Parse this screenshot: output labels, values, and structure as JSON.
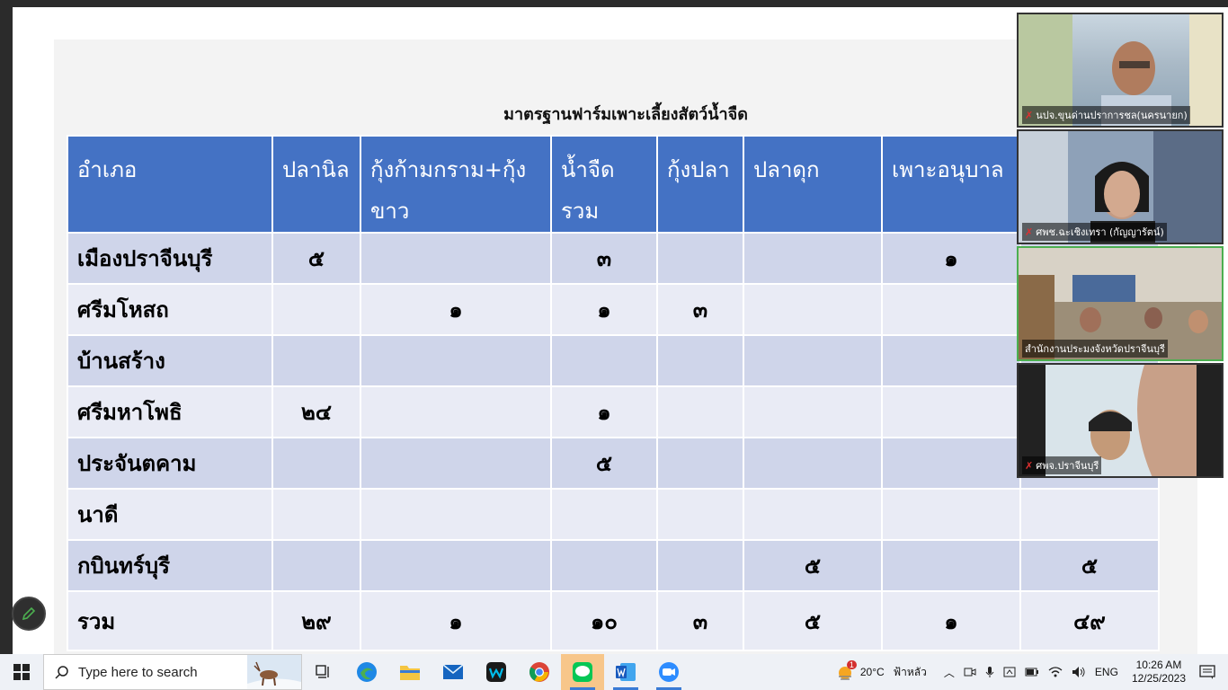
{
  "slide": {
    "title": "มาตรฐานฟาร์มเพาะเลี้ยงสัตว์น้ำจืด",
    "headers": [
      "อำเภอ",
      "ปลานิล",
      "กุ้งก้ามกราม+กุ้งขาว",
      "น้ำจืดรวม",
      "กุ้งปลา",
      "ปลาดุก",
      "เพาะอนุบาล",
      ""
    ],
    "rows": [
      {
        "name": "เมืองปราจีนบุรี",
        "c1": "๕",
        "c2": "",
        "c3": "๓",
        "c4": "",
        "c5": "",
        "c6": "๑",
        "c7": ""
      },
      {
        "name": "ศรีมโหสถ",
        "c1": "",
        "c2": "๑",
        "c3": "๑",
        "c4": "๓",
        "c5": "",
        "c6": "",
        "c7": ""
      },
      {
        "name": "บ้านสร้าง",
        "c1": "",
        "c2": "",
        "c3": "",
        "c4": "",
        "c5": "",
        "c6": "",
        "c7": ""
      },
      {
        "name": "ศรีมหาโพธิ",
        "c1": "๒๔",
        "c2": "",
        "c3": "๑",
        "c4": "",
        "c5": "",
        "c6": "",
        "c7": ""
      },
      {
        "name": "ประจันตคาม",
        "c1": "",
        "c2": "",
        "c3": "๕",
        "c4": "",
        "c5": "",
        "c6": "",
        "c7": ""
      },
      {
        "name": "นาดี",
        "c1": "",
        "c2": "",
        "c3": "",
        "c4": "",
        "c5": "",
        "c6": "",
        "c7": ""
      },
      {
        "name": "กบินทร์บุรี",
        "c1": "",
        "c2": "",
        "c3": "",
        "c4": "",
        "c5": "๕",
        "c6": "",
        "c7": "๕"
      },
      {
        "name": "รวม",
        "c1": "๒๙",
        "c2": "๑",
        "c3": "๑๐",
        "c4": "๓",
        "c5": "๕",
        "c6": "๑",
        "c7": "๔๙"
      }
    ]
  },
  "video": {
    "participants": [
      {
        "name": "นปจ.ขุนด่านปราการชล(นครนายก)",
        "muted": true
      },
      {
        "name": "ศพช.ฉะเชิงเทรา (กัญญารัตน์)",
        "muted": true
      },
      {
        "name": "สำนักงานประมงจังหวัดปราจีนบุรี",
        "muted": false
      },
      {
        "name": "ศพจ.ปราจีนบุรี",
        "muted": true
      }
    ]
  },
  "taskbar": {
    "search_placeholder": "Type here to search",
    "apps": [
      "task-view",
      "edge",
      "file-explorer",
      "mail",
      "webex",
      "chrome",
      "line",
      "word",
      "zoom"
    ],
    "weather": "20°C",
    "weather_desc": "ฟ้าหลัว",
    "weather_badge": "1",
    "lang": "ENG",
    "time": "10:26 AM",
    "date": "12/25/2023"
  },
  "colors": {
    "header_blue": "#4472c4",
    "row_dark": "#cfd5ea",
    "row_light": "#e9ebf5"
  }
}
